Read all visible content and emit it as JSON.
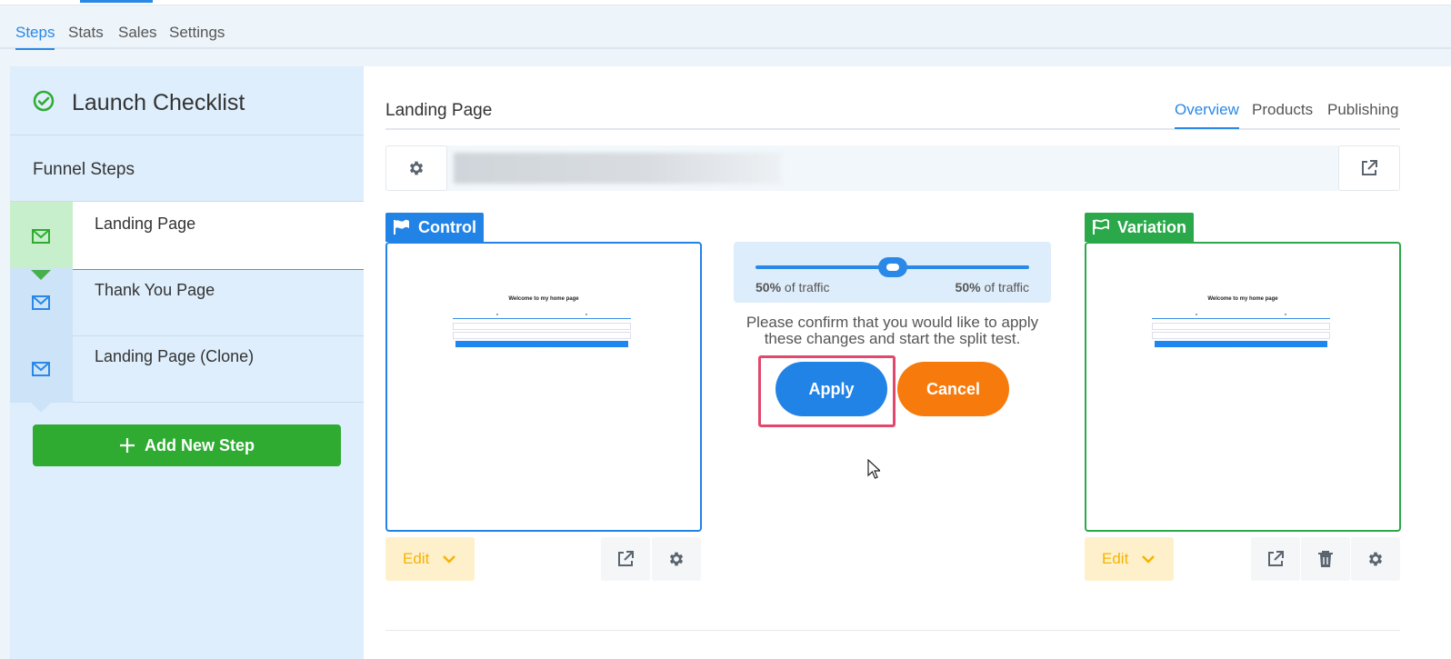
{
  "top_tabs": [
    {
      "label": "Steps",
      "active": true
    },
    {
      "label": "Stats",
      "active": false
    },
    {
      "label": "Sales",
      "active": false
    },
    {
      "label": "Settings",
      "active": false
    }
  ],
  "sidebar": {
    "checklist_title": "Launch Checklist",
    "funnel_steps_heading": "Funnel Steps",
    "steps": [
      {
        "label": "Landing Page",
        "icon": "mail-icon",
        "active": true
      },
      {
        "label": "Thank You Page",
        "icon": "mail-icon",
        "active": false
      },
      {
        "label": "Landing Page (Clone)",
        "icon": "mail-icon",
        "active": false
      }
    ],
    "add_step_label": "Add New Step"
  },
  "page": {
    "title": "Landing Page",
    "tabs": [
      {
        "label": "Overview",
        "active": true
      },
      {
        "label": "Products",
        "active": false
      },
      {
        "label": "Publishing",
        "active": false
      }
    ]
  },
  "control": {
    "tag": "Control",
    "preview_title": "Welcome to my home page",
    "edit_label": "Edit"
  },
  "variation": {
    "tag": "Variation",
    "preview_title": "Welcome to my home page",
    "edit_label": "Edit"
  },
  "split": {
    "left_percent": "50%",
    "right_percent": "50%",
    "traffic_suffix": "of traffic",
    "slider_value": 0.5,
    "confirm_line1": "Please confirm that you would like to apply",
    "confirm_line2": "these changes and start the split test.",
    "apply_label": "Apply",
    "cancel_label": "Cancel"
  },
  "colors": {
    "accent": "#2a88e6",
    "success": "#2fab32",
    "control": "#2183e6",
    "variation": "#2aa84a",
    "cancel": "#f77a0c",
    "highlight": "#e3476b",
    "edit": "#f5b400"
  }
}
